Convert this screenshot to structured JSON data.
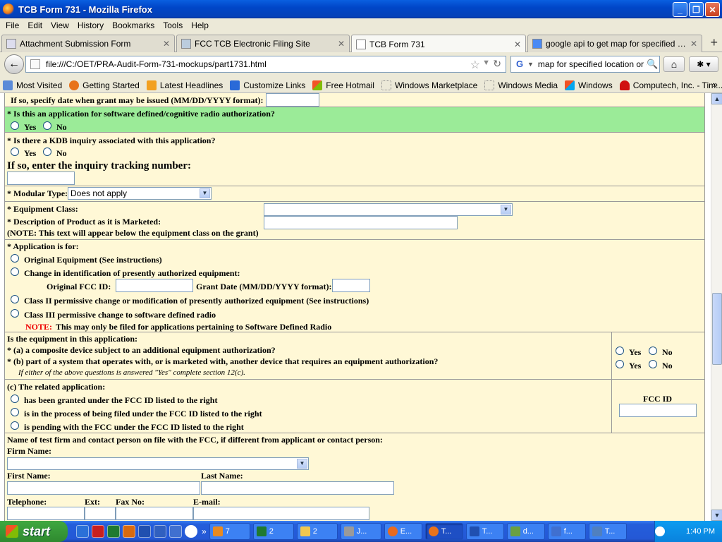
{
  "window": {
    "title": "TCB Form 731 - Mozilla Firefox"
  },
  "menu": [
    "File",
    "Edit",
    "View",
    "History",
    "Bookmarks",
    "Tools",
    "Help"
  ],
  "tabs": [
    {
      "label": "Attachment Submission Form"
    },
    {
      "label": "FCC TCB Electronic Filing Site"
    },
    {
      "label": "TCB Form 731"
    },
    {
      "label": "google api to get map for specified locati..."
    }
  ],
  "nav": {
    "url": "file:///C:/OET/PRA-Audit-Form-731-mockups/part1731.html",
    "search_text": "map for specified location or cit"
  },
  "bookmarks": [
    "Most Visited",
    "Getting Started",
    "Latest Headlines",
    "Customize Links",
    "Free Hotmail",
    "Windows Marketplace",
    "Windows Media",
    "Windows",
    "Computech, Inc. - Tim..."
  ],
  "form": {
    "grant_date_label": "If so, specify date when grant may be issued (MM/DD/YYYY format):",
    "sdr_question": "* Is this an application for software defined/cognitive radio authorization?",
    "yes": "Yes",
    "no": "No",
    "kdb_question": "* Is there a KDB inquiry associated with this application?",
    "kdb_tracking_label": "If so, enter the inquiry tracking number:",
    "modular_type_label": "* Modular Type:",
    "modular_type_value": "Does not apply",
    "equipment_class_label": "* Equipment Class:",
    "description_label": "* Description of Product as it is Marketed:",
    "description_note": "(NOTE: This text will appear below the equipment class on the grant)",
    "application_for_label": "* Application is for:",
    "app_options": [
      "Original Equipment (See instructions)",
      "Change in identification of presently authorized equipment:",
      "Class II permissive change or modification of presently authorized equipment (See instructions)",
      "Class III permissive change to software defined radio"
    ],
    "original_fcc_id_label": "Original FCC ID:",
    "grant_date_short_label": "Grant Date (MM/DD/YYYY format):",
    "note_prefix": "NOTE:",
    "note_text": "This may only be filed for applications pertaining to Software Defined Radio",
    "equipment_question": "Is the equipment in this application:",
    "q_a": "* (a) a composite device subject to an additional equipment authorization?",
    "q_b": "* (b) part of a system that operates with, or is marketed with, another device that requires an equipment authorization?",
    "q_note": "If either of the above questions is answered \"Yes\" complete section 12(c).",
    "related_app_label": "(c) The related application:",
    "related_options": [
      "has been granted under the FCC ID listed to the right",
      "is in the process of being filed under the FCC ID listed to the right",
      "is pending with the FCC under the FCC ID listed to the right"
    ],
    "fcc_id_label": "FCC ID",
    "test_firm_label": "Name of test firm and contact person on file with the FCC, if different from applicant or contact person:",
    "firm_name_label": "Firm Name:",
    "first_name_label": "First Name:",
    "last_name_label": "Last Name:",
    "telephone_label": "Telephone:",
    "ext_label": "Ext:",
    "fax_label": "Fax No:",
    "email_label": "E-mail:"
  },
  "taskbar": {
    "start": "start",
    "items": [
      "7",
      "2",
      "2",
      "J...",
      "E...",
      "T...",
      "T...",
      "d...",
      "f...",
      "T..."
    ],
    "clock": "1:40 PM"
  },
  "colors": {
    "green_row": "#9BEB98",
    "cream_row": "#FFF8D6",
    "note_red": "#E00000",
    "xp_blue": "#245EDB"
  }
}
